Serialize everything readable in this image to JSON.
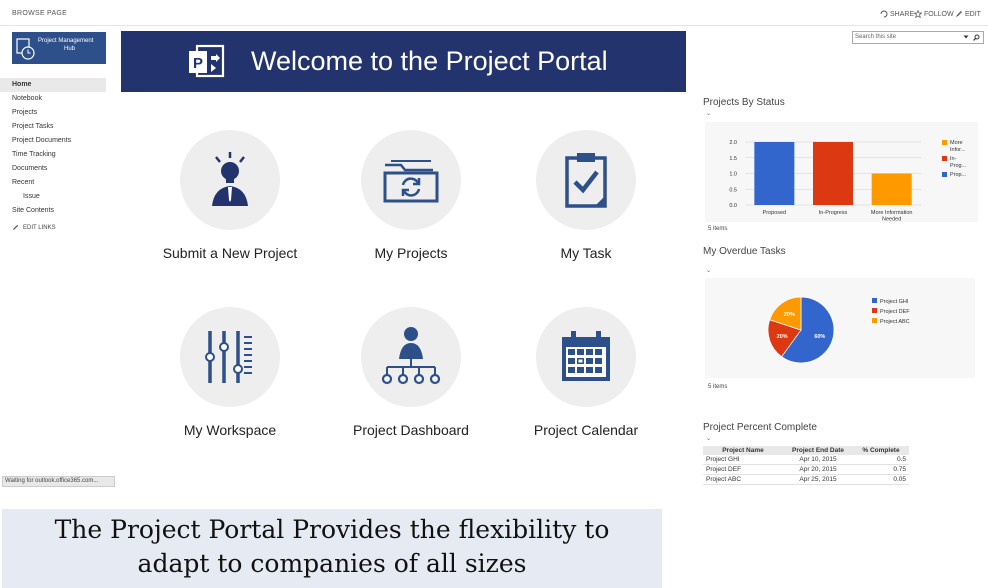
{
  "ribbon": {
    "tabs": [
      "BROWSE",
      "PAGE"
    ],
    "actions": {
      "share": "SHARE",
      "follow": "FOLLOW",
      "edit": "EDIT"
    }
  },
  "site_logo": {
    "line1": "Project Management",
    "line2": "Hub"
  },
  "search": {
    "placeholder": "Search this site"
  },
  "left_nav": {
    "items": [
      "Home",
      "Notebook",
      "Projects",
      "Project Tasks",
      "Project Documents",
      "Time Tracking",
      "Documents",
      "Recent",
      "Issue",
      "Site Contents"
    ],
    "edit_links": "EDIT LINKS"
  },
  "status_bar": {
    "text": "Waiting for outlook.office365.com..."
  },
  "banner": {
    "title": "Welcome to the Project Portal"
  },
  "tiles": [
    {
      "label": "Submit a New Project",
      "icon": "idea-person-icon"
    },
    {
      "label": "My Projects",
      "icon": "folder-sync-icon"
    },
    {
      "label": "My Task",
      "icon": "clipboard-check-icon"
    },
    {
      "label": "My Workspace",
      "icon": "sliders-icon"
    },
    {
      "label": "Project Dashboard",
      "icon": "org-chart-icon"
    },
    {
      "label": "Project Calendar",
      "icon": "calendar-icon"
    }
  ],
  "status_webpart": {
    "title": "Projects By Status",
    "caret": "⌄",
    "count": "5 items"
  },
  "overdue_webpart": {
    "title": "My Overdue Tasks",
    "caret": "⌄",
    "count": "5 items"
  },
  "percent_webpart": {
    "title": "Project Percent Complete",
    "caret": "⌄",
    "columns": [
      "Project Name",
      "Project End Date",
      "% Complete"
    ],
    "rows": [
      [
        "Project GHI",
        "Apr 10, 2015",
        "0.5"
      ],
      [
        "Project DEF",
        "Apr 20, 2015",
        "0.75"
      ],
      [
        "Project ABC",
        "Apr 25, 2015",
        "0.05"
      ]
    ]
  },
  "caption": {
    "line1": "The Project Portal Provides the flexibility to",
    "line2": "adapt to companies of all sizes"
  },
  "colors": {
    "banner": "#23336e",
    "blue": "#3366cc",
    "red": "#dc3912",
    "orange": "#ff9900",
    "icon": "#2d4f8a"
  },
  "chart_data": [
    {
      "type": "bar",
      "categories": [
        "Proposed",
        "In-Progress",
        "More Information Needed"
      ],
      "values": [
        2.0,
        2.0,
        1.0
      ],
      "colors": [
        "#3366cc",
        "#dc3912",
        "#ff9900"
      ],
      "ylim": [
        0,
        2.0
      ],
      "yticks": [
        "0.0",
        "0.5",
        "1.0",
        "1.5",
        "2.0"
      ],
      "legend": [
        "More Infor...",
        "In-Prog...",
        "Prop..."
      ],
      "legend_colors": [
        "#ff9900",
        "#dc3912",
        "#3366cc"
      ],
      "legend_position": "right"
    },
    {
      "type": "pie",
      "labels": [
        "Project GHI",
        "Project DEF",
        "Project ABC"
      ],
      "values": [
        60,
        20,
        20
      ],
      "slice_labels": [
        "60%",
        "20%",
        "20%"
      ],
      "colors": [
        "#3366cc",
        "#dc3912",
        "#ff9900"
      ],
      "legend_position": "right"
    }
  ]
}
